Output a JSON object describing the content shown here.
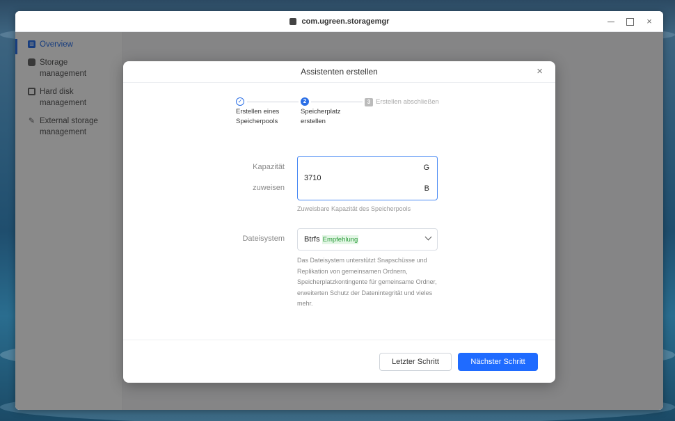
{
  "window": {
    "title": "com.ugreen.storagemgr"
  },
  "sidebar": {
    "items": [
      {
        "label": "Overview",
        "icon": "overview-icon",
        "active": true
      },
      {
        "label": "Storage management",
        "icon": "storage-icon",
        "active": false
      },
      {
        "label": "Hard disk management",
        "icon": "hard-disk-icon",
        "active": false
      },
      {
        "label": "External storage management",
        "icon": "external-storage-icon",
        "active": false
      }
    ]
  },
  "dialog": {
    "title": "Assistenten erstellen",
    "close_symbol": "×",
    "steps": [
      {
        "label": "Erstellen eines Speicherpools",
        "state": "done",
        "marker": "✓"
      },
      {
        "label": "Speicherplatz erstellen",
        "state": "current",
        "marker": "2"
      },
      {
        "label": "Erstellen abschließen",
        "state": "pending",
        "marker": "3"
      }
    ],
    "capacity": {
      "label_line1": "Kapazität",
      "label_line2": "zuweisen",
      "value": "3710",
      "unit_line1": "G",
      "unit_line2": "B",
      "hint": "Zuweisbare Kapazität des Speicherpools"
    },
    "filesystem": {
      "label": "Dateisystem",
      "value": "Btrfs",
      "badge": "Empfehlung",
      "description": "Das Dateisystem unterstützt Snapschüsse und Replikation von gemeinsamen Ordnern, Speicherplatzkontingente für gemeinsame Ordner, erweiterten Schutz der Datenintegrität und vieles mehr."
    },
    "buttons": {
      "previous": "Letzter Schritt",
      "next": "Nächster Schritt"
    }
  },
  "colors": {
    "accent": "#1f6bff",
    "badge_text": "#2d9c3c",
    "badge_bg": "#e3f6e5"
  }
}
